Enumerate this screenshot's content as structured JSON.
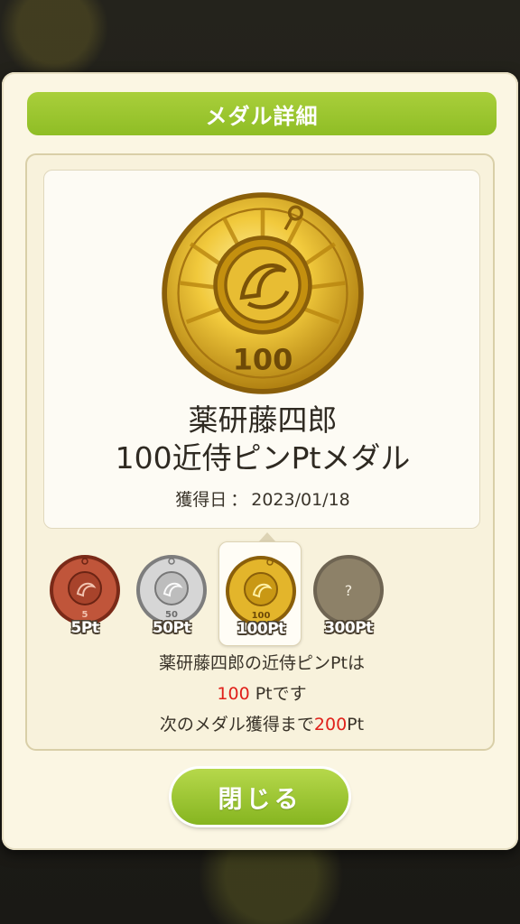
{
  "dialog": {
    "title": "メダル詳細",
    "close_label": "閉じる"
  },
  "detail": {
    "medal_number": "100",
    "name_line1": "薬研藤四郎",
    "name_line2": "100近侍ピンPtメダル",
    "acquired_label": "獲得日",
    "acquired_sep": "：",
    "acquired_date": "2023/01/18"
  },
  "medals": [
    {
      "pt_label": "5Pt",
      "face_number": "5",
      "tier": "bronze",
      "color": "#c0553a"
    },
    {
      "pt_label": "50Pt",
      "face_number": "50",
      "tier": "silver",
      "color": "#c9c9c9"
    },
    {
      "pt_label": "100Pt",
      "face_number": "100",
      "tier": "gold",
      "color": "#d9a91d",
      "selected": true
    },
    {
      "pt_label": "300Pt",
      "face_number": "?",
      "tier": "locked",
      "color": "#8d8168"
    }
  ],
  "info": {
    "line1": "薬研藤四郎の近侍ピンPtは",
    "line2_value": "100",
    "line2_suffix": " Ptです",
    "line3_prefix": "次のメダル獲得まで",
    "line3_value": "200",
    "line3_suffix": "Pt"
  },
  "colors": {
    "accent_green": "#9ac62e",
    "highlight_red": "#e0201a",
    "panel_bg": "#fbf6e3"
  }
}
